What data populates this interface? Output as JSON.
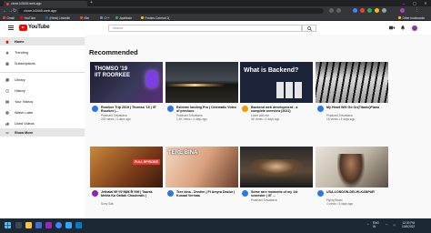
{
  "browser": {
    "tab_title": "clone-b3445.web.app",
    "address": "clone-b3445.web.app",
    "bookmarks": [
      {
        "label": "Gmail",
        "color": "#ea4335"
      },
      {
        "label": "YouTube",
        "color": "#ff0000"
      },
      {
        "label": "(Hired) LinkedIn",
        "color": "#0a66c2"
      },
      {
        "label": "Kite",
        "color": "#f6461a"
      },
      {
        "label": "C++",
        "color": "#5c8dbc"
      },
      {
        "label": "Apatitude",
        "color": "#34a853"
      },
      {
        "label": "Fosters Carnival 2(",
        "color": "#fbbc04"
      }
    ],
    "other_bookmarks": "Other bookmarks"
  },
  "header": {
    "logo_text": "YouTube",
    "search_placeholder": "Search"
  },
  "sidebar": {
    "items": [
      {
        "label": "Home",
        "icon": "home-icon"
      },
      {
        "label": "Trending",
        "icon": "trending-icon"
      },
      {
        "label": "Subscriptions",
        "icon": "subscriptions-icon"
      },
      {
        "label": "Library",
        "icon": "library-icon"
      },
      {
        "label": "History",
        "icon": "history-icon"
      },
      {
        "label": "Your Videos",
        "icon": "your-videos-icon"
      },
      {
        "label": "Watch Later",
        "icon": "watch-later-icon"
      },
      {
        "label": "Liked Videos",
        "icon": "liked-videos-icon"
      },
      {
        "label": "Show More",
        "icon": "chevron-down-icon"
      }
    ]
  },
  "main": {
    "heading": "Recommended",
    "videos": [
      {
        "title": "Roorkee Trip 2019 | Thomso '19 | IIT Roorkee |...",
        "channel": "Prashant Srivastava",
        "stats": "243 views • 4 days ago",
        "thumb_text": "THOMSO '19\nIIT ROORKEE",
        "avatar_color": "#2b78e4"
      },
      {
        "title": "Extreme landing Pro | Cinematic Video of previous",
        "channel": "Prashant Srivastava",
        "stats": "1.4K views • 4 days ago",
        "thumb_text": "",
        "avatar_color": "#2b78e4"
      },
      {
        "title": "Backend web development - a complete overview (2021)",
        "channel": "Learn with me",
        "stats": "4K views • 4 days ago",
        "thumb_text": "What is Backend?",
        "avatar_color": "#f29900"
      },
      {
        "title": "My Heart Will Go On(Titanic)Piano",
        "channel": "Prashant Srivastava",
        "stats": "1K views • 4 days ago",
        "thumb_text": "",
        "avatar_color": "#2b78e4"
      },
      {
        "title": "Jethalal बन गए सड़क के राजा | Taarak Mehta Ka Ooltah Chashmah |",
        "channel": "Sony Sab",
        "stats": "",
        "thumb_text": "FULL EPISODE",
        "avatar_color": "#8e24aa"
      },
      {
        "title": "Tere bina - Zeeden | Ft Amyra Dastur | Kunaal Vermaa",
        "channel": "",
        "stats": "",
        "thumb_text": "TERE BINA",
        "avatar_color": "#2b78e4"
      },
      {
        "title": "Some rare moments of my 1st semester | IIT ...",
        "channel": "Prashant Srivastava",
        "stats": "",
        "thumb_text": "",
        "avatar_color": "#2b78e4"
      },
      {
        "title": "USA-LONDON-DELHI-KANPUR",
        "channel": "Flying Beast",
        "stats": "4 views • 4 days ago",
        "thumb_text": "",
        "avatar_color": "#2b78e4"
      }
    ]
  },
  "taskbar": {
    "lang": "ENG",
    "region": "IN",
    "time": "12:30 PM",
    "date": "10/5/2022"
  }
}
